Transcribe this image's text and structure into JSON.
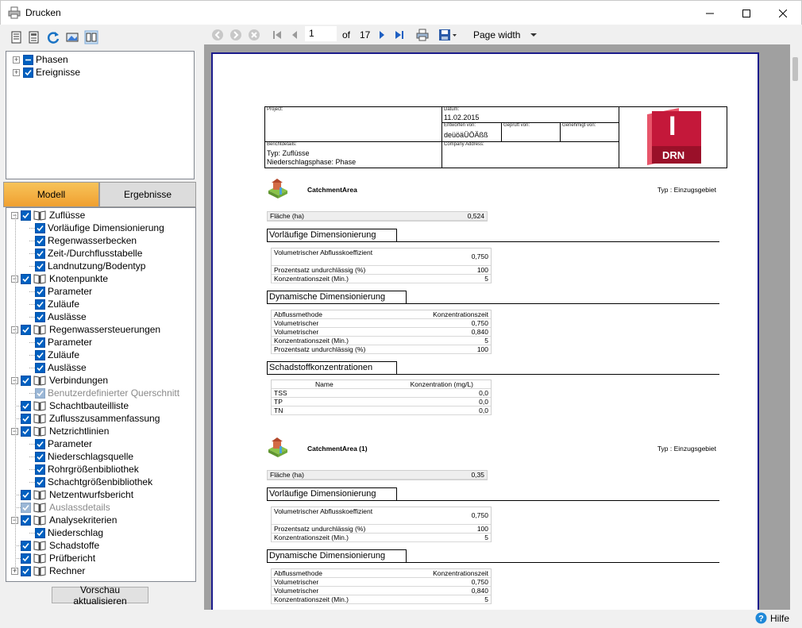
{
  "window": {
    "title": "Drucken"
  },
  "left_tree_top": [
    {
      "label": "Phasen",
      "checked": "partial"
    },
    {
      "label": "Ereignisse",
      "checked": "true"
    }
  ],
  "tabs": {
    "active": "Modell",
    "inactive": "Ergebnisse"
  },
  "tree": [
    {
      "label": "Zuflüsse",
      "level": 0,
      "expanded": true,
      "disabled": false
    },
    {
      "label": "Vorläufige Dimensionierung",
      "level": 1,
      "disabled": false
    },
    {
      "label": "Regenwasserbecken",
      "level": 1,
      "disabled": false
    },
    {
      "label": "Zeit-/Durchflusstabelle",
      "level": 1,
      "disabled": false
    },
    {
      "label": "Landnutzung/Bodentyp",
      "level": 1,
      "disabled": false
    },
    {
      "label": "Knotenpunkte",
      "level": 0,
      "expanded": true,
      "disabled": false
    },
    {
      "label": "Parameter",
      "level": 1,
      "disabled": false
    },
    {
      "label": "Zuläufe",
      "level": 1,
      "disabled": false
    },
    {
      "label": "Auslässe",
      "level": 1,
      "disabled": false
    },
    {
      "label": "Regenwassersteuerungen",
      "level": 0,
      "expanded": true,
      "disabled": false
    },
    {
      "label": "Parameter",
      "level": 1,
      "disabled": false
    },
    {
      "label": "Zuläufe",
      "level": 1,
      "disabled": false
    },
    {
      "label": "Auslässe",
      "level": 1,
      "disabled": false
    },
    {
      "label": "Verbindungen",
      "level": 0,
      "expanded": true,
      "disabled": false
    },
    {
      "label": "Benutzerdefinierter Querschnitt",
      "level": 1,
      "disabled": true
    },
    {
      "label": "Schachtbauteilliste",
      "level": 0,
      "expanded": null,
      "disabled": false
    },
    {
      "label": "Zuflusszusammenfassung",
      "level": 0,
      "expanded": null,
      "disabled": false
    },
    {
      "label": "Netzrichtlinien",
      "level": 0,
      "expanded": true,
      "disabled": false
    },
    {
      "label": "Parameter",
      "level": 1,
      "disabled": false
    },
    {
      "label": "Niederschlagsquelle",
      "level": 1,
      "disabled": false
    },
    {
      "label": "Rohrgrößenbibliothek",
      "level": 1,
      "disabled": false
    },
    {
      "label": "Schachtgrößenbibliothek",
      "level": 1,
      "disabled": false
    },
    {
      "label": "Netzentwurfsbericht",
      "level": 0,
      "expanded": null,
      "disabled": false
    },
    {
      "label": "Auslassdetails",
      "level": 0,
      "expanded": null,
      "disabled": true
    },
    {
      "label": "Analysekriterien",
      "level": 0,
      "expanded": true,
      "disabled": false
    },
    {
      "label": "Niederschlag",
      "level": 1,
      "disabled": false
    },
    {
      "label": "Schadstoffe",
      "level": 0,
      "expanded": null,
      "disabled": false
    },
    {
      "label": "Prüfbericht",
      "level": 0,
      "expanded": null,
      "disabled": false
    },
    {
      "label": "Rechner",
      "level": 0,
      "expanded": false,
      "disabled": false
    }
  ],
  "refresh_button": "Vorschau aktualisieren",
  "viewer": {
    "page_current": "1",
    "of_label": "of",
    "page_total": "17",
    "zoom": "Page width"
  },
  "report": {
    "header": {
      "project_label": "Project:",
      "date_label": "Datum:",
      "date_value": "11.02.2015",
      "designed_label": "Entworfen von:",
      "designed_value": "deüöäÜÖÄßß",
      "checked_label": "Geprüft von:",
      "approved_label": "Genehmigt von:",
      "report_details_label": "Berichtdetails:",
      "type_line": "Typ: Zuflüsse",
      "phase_line": "Niederschlagsphase: Phase",
      "company_label": "Company Address:",
      "logo_letter": "I",
      "logo_text": "DRN"
    },
    "areas": [
      {
        "name": "CatchmentArea",
        "type": "Typ : Einzugsgebiet",
        "area_label": "Fläche (ha)",
        "area_value": "0,524",
        "prelim_title": "Vorläufige Dimensionierung",
        "prelim_rows": [
          {
            "label": "Volumetrischer Abflusskoeffizient",
            "value": "0,750"
          },
          {
            "label": "Prozentsatz undurchlässig (%)",
            "value": "100"
          },
          {
            "label": "Konzentrationszeit (Min.)",
            "value": "5"
          }
        ],
        "dyn_title": "Dynamische Dimensionierung",
        "dyn_rows": [
          {
            "label": "Abflussmethode",
            "value": "Konzentrationszeit"
          },
          {
            "label": "Volumetrischer",
            "value": "0,750"
          },
          {
            "label": "Volumetrischer",
            "value": "0,840"
          },
          {
            "label": "Konzentrationszeit (Min.)",
            "value": "5"
          },
          {
            "label": "Prozentsatz undurchlässig (%)",
            "value": "100"
          }
        ],
        "pollutant_title": "Schadstoffkonzentrationen",
        "pollutant_headers": [
          "Name",
          "Konzentration (mg/L)"
        ],
        "pollutant_rows": [
          {
            "label": "TSS",
            "value": "0,0"
          },
          {
            "label": "TP",
            "value": "0,0"
          },
          {
            "label": "TN",
            "value": "0,0"
          }
        ]
      },
      {
        "name": "CatchmentArea (1)",
        "type": "Typ : Einzugsgebiet",
        "area_label": "Fläche (ha)",
        "area_value": "0,35",
        "prelim_title": "Vorläufige Dimensionierung",
        "prelim_rows": [
          {
            "label": "Volumetrischer Abflusskoeffizient",
            "value": "0,750"
          },
          {
            "label": "Prozentsatz undurchlässig (%)",
            "value": "100"
          },
          {
            "label": "Konzentrationszeit (Min.)",
            "value": "5"
          }
        ],
        "dyn_title": "Dynamische Dimensionierung",
        "dyn_rows": [
          {
            "label": "Abflussmethode",
            "value": "Konzentrationszeit"
          },
          {
            "label": "Volumetrischer",
            "value": "0,750"
          },
          {
            "label": "Volumetrischer",
            "value": "0,840"
          },
          {
            "label": "Konzentrationszeit (Min.)",
            "value": "5"
          }
        ]
      }
    ]
  },
  "status": {
    "help_label": "Hilfe"
  },
  "colors": {
    "accent_tab": "#f0a030",
    "checkbox": "#0060c0",
    "logo": "#c4183a"
  }
}
